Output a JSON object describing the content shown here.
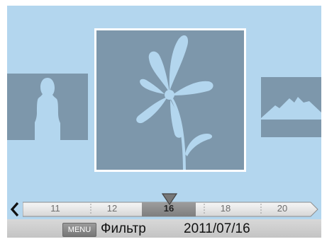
{
  "timeline": {
    "ticks": [
      "11",
      "12",
      "16",
      "18",
      "20"
    ],
    "selected": "16"
  },
  "bottom_bar": {
    "menu_button": "MENU",
    "menu_label": "Фильтр",
    "date": "2011/07/16"
  },
  "colors": {
    "background": "#b3d6ee",
    "thumbnail": "#7d97ab",
    "silhouette": "#b3d6ee",
    "selection_border": "#ffffff"
  },
  "icons": {
    "left_thumbnail": "person-silhouette-icon",
    "center_thumbnail": "flower-silhouette-icon",
    "right_thumbnail": "mountain-silhouette-icon",
    "scroll_left": "chevron-left-icon",
    "position_marker": "triangle-down-icon"
  }
}
